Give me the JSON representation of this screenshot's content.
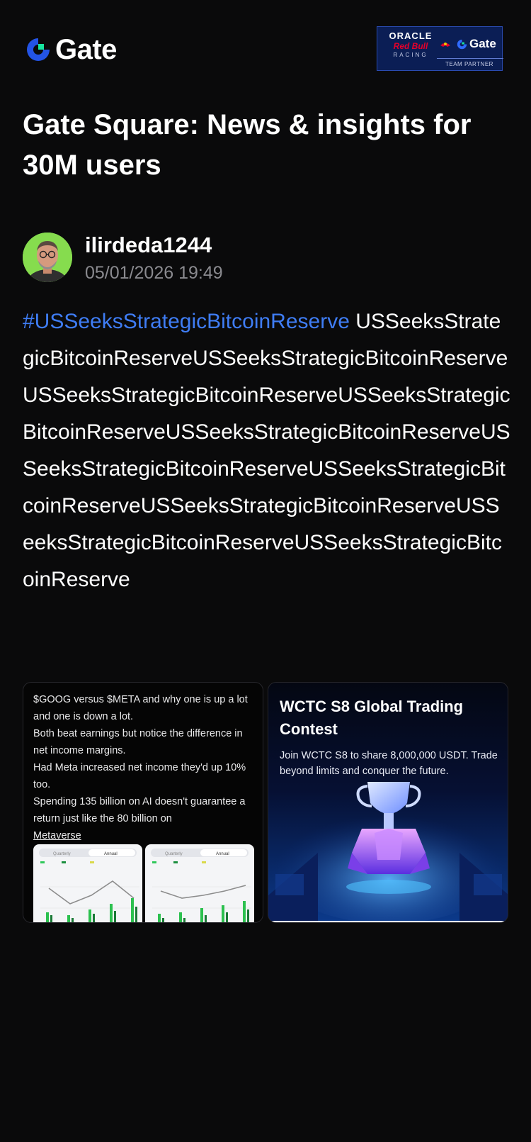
{
  "header": {
    "logo_text": "Gate",
    "partner_badge": {
      "line1": "ORACLE",
      "line2": "Red Bull",
      "line3": "RACING",
      "brand": "Gate",
      "caption": "TEAM PARTNER"
    }
  },
  "page_title": "Gate Square: News & insights for 30M users",
  "post": {
    "author": "ilirdeda1244",
    "timestamp": "05/01/2026 19:49",
    "hashtag": "#USSeeksStrategicBitcoinReserve",
    "body": "USSeeksStrategicBitcoinReserveUSSeeksStrategicBitcoinReserveUSSeeksStrategicBitcoinReserveUSSeeksStrategicBitcoinReserveUSSeeksStrategicBitcoinReserveUSSeeksStrategicBitcoinReserveUSSeeksStrategicBitcoinReserveUSSeeksStrategicBitcoinReserveUSSeeksStrategicBitcoinReserveUSSeeksStrategicBitcoinReserve"
  },
  "media": {
    "left": {
      "lines": [
        "$GOOG versus $META and why one is up a lot and one is down a lot.",
        "Both beat earnings but notice the difference in net income margins.",
        "Had Meta increased net income they'd up 10% too.",
        "Spending 135 billion on AI doesn't guarantee a return just like the 80 billion on"
      ],
      "link": "Metaverse",
      "chart_tabs": [
        "Quarterly",
        "Annual"
      ]
    },
    "right": {
      "title": "WCTC S8 Global Trading Contest",
      "subtitle": "Join WCTC S8 to share 8,000,000 USDT. Trade beyond limits and conquer the future."
    }
  },
  "colors": {
    "background": "#0a0a0b",
    "hashtag": "#3f7df5",
    "muted": "#8a8a8f",
    "brand_blue": "#2354e6",
    "brand_green": "#17e6a1"
  }
}
